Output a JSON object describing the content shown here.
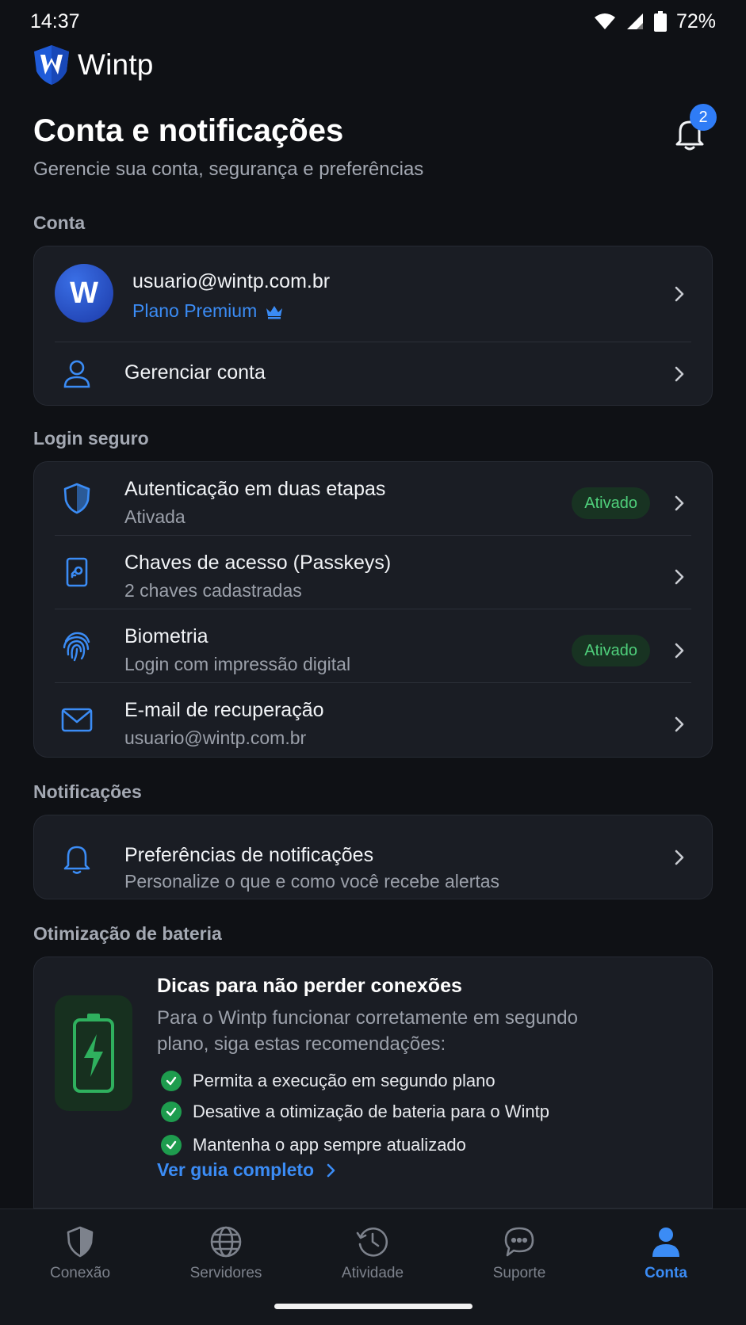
{
  "status": {
    "time": "14:37",
    "battery": "72%"
  },
  "brand": {
    "name": "Wintp"
  },
  "header": {
    "title": "Conta e notificações",
    "subtitle": "Gerencie sua conta, segurança e preferências",
    "notification_count": "2"
  },
  "account": {
    "section_label": "Conta",
    "avatar_letter": "W",
    "email": "usuario@wintp.com.br",
    "plan": "Plano Premium",
    "manage_label": "Gerenciar conta"
  },
  "secure_login": {
    "section_label": "Login seguro",
    "items": [
      {
        "title": "Autenticação em duas etapas",
        "subtitle": "Ativada",
        "badge": "Ativado",
        "icon": "shield-icon"
      },
      {
        "title": "Chaves de acesso (Passkeys)",
        "subtitle": "2 chaves cadastradas",
        "badge": "",
        "icon": "passkey-icon"
      },
      {
        "title": "Biometria",
        "subtitle": "Login com impressão digital",
        "badge": "Ativado",
        "icon": "fingerprint-icon"
      },
      {
        "title": "E-mail de recuperação",
        "subtitle": "usuario@wintp.com.br",
        "badge": "",
        "icon": "mail-icon"
      }
    ]
  },
  "notifications": {
    "section_label": "Notificações",
    "title": "Preferências de notificações",
    "subtitle": "Personalize o que e como você recebe alertas"
  },
  "battery": {
    "section_label": "Otimização de bateria",
    "title": "Dicas para não perder conexões",
    "description": "Para o Wintp funcionar corretamente em segundo plano, siga estas recomendações:",
    "tips": [
      "Permita a execução em segundo plano",
      "Desative a otimização de bateria para o Wintp",
      "Mantenha o app sempre atualizado"
    ],
    "link": "Ver guia completo"
  },
  "nav": {
    "items": [
      {
        "label": "Conexão",
        "icon": "shield-icon"
      },
      {
        "label": "Servidores",
        "icon": "globe-icon"
      },
      {
        "label": "Atividade",
        "icon": "history-icon"
      },
      {
        "label": "Suporte",
        "icon": "chat-icon"
      },
      {
        "label": "Conta",
        "icon": "user-icon"
      }
    ],
    "active_index": 4
  },
  "colors": {
    "background": "#0f1115",
    "card": "#1a1d24",
    "accent": "#3b8cf5",
    "success": "#4fcf7b"
  }
}
